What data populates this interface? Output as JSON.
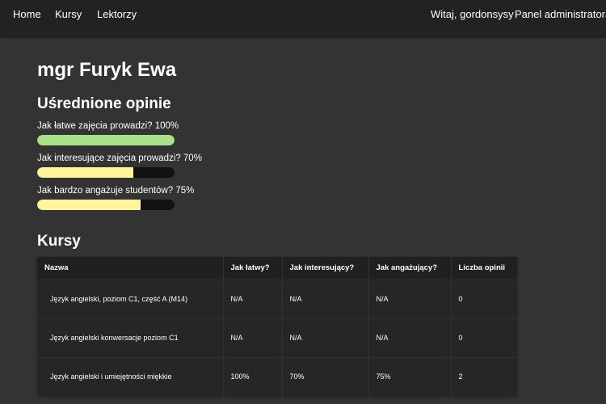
{
  "nav": {
    "home": "Home",
    "courses": "Kursy",
    "lecturers": "Lektorzy",
    "greeting": "Witaj, gordonsysy",
    "admin": "Panel administratora"
  },
  "page_title": "mgr Furyk Ewa",
  "ratings_title": "Uśrednione opinie",
  "ratings": [
    {
      "label": "Jak łatwe zajęcia prowadzi? 100%",
      "value": 100,
      "color": "#a8e08c"
    },
    {
      "label": "Jak interesujące zajęcia prowadzi? 70%",
      "value": 70,
      "color": "#fff59d"
    },
    {
      "label": "Jak bardzo angażuje studentów? 75%",
      "value": 75,
      "color": "#fff59d"
    }
  ],
  "courses_title": "Kursy",
  "table": {
    "headers": [
      "Nazwa",
      "Jak łatwy?",
      "Jak interesujący?",
      "Jak angażujący?",
      "Liczba opinii"
    ],
    "rows": [
      [
        "Język angielski, poziom C1, część A (M14)",
        "N/A",
        "N/A",
        "N/A",
        "0"
      ],
      [
        "Język angielski konwersacje poziom C1",
        "N/A",
        "N/A",
        "N/A",
        "0"
      ],
      [
        "Język angielski i umiejętności miękkie",
        "100%",
        "70%",
        "75%",
        "2"
      ]
    ]
  },
  "colors": {
    "background": "#333333",
    "navbar": "#222222",
    "bar_track": "#111111"
  }
}
